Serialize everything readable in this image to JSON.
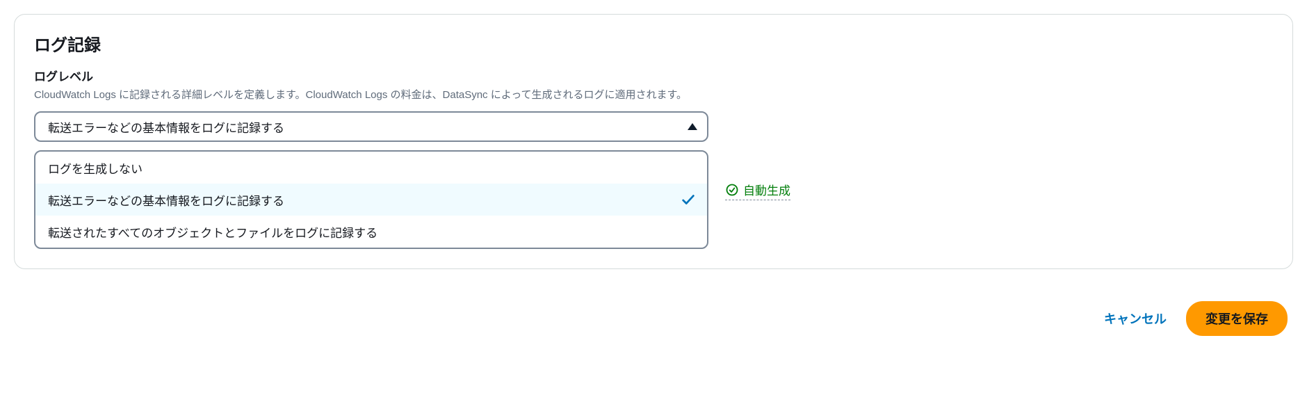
{
  "panel": {
    "title": "ログ記録",
    "field_label": "ログレベル",
    "field_description": "CloudWatch Logs に記録される詳細レベルを定義します。CloudWatch Logs の料金は、DataSync によって生成されるログに適用されます。"
  },
  "select": {
    "value": "転送エラーなどの基本情報をログに記録する",
    "options": [
      {
        "label": "ログを生成しない",
        "selected": false
      },
      {
        "label": "転送エラーなどの基本情報をログに記録する",
        "selected": true
      },
      {
        "label": "転送されたすべてのオブジェクトとファイルをログに記録する",
        "selected": false
      }
    ]
  },
  "autogen": {
    "label": "自動生成"
  },
  "actions": {
    "cancel": "キャンセル",
    "save": "変更を保存"
  }
}
